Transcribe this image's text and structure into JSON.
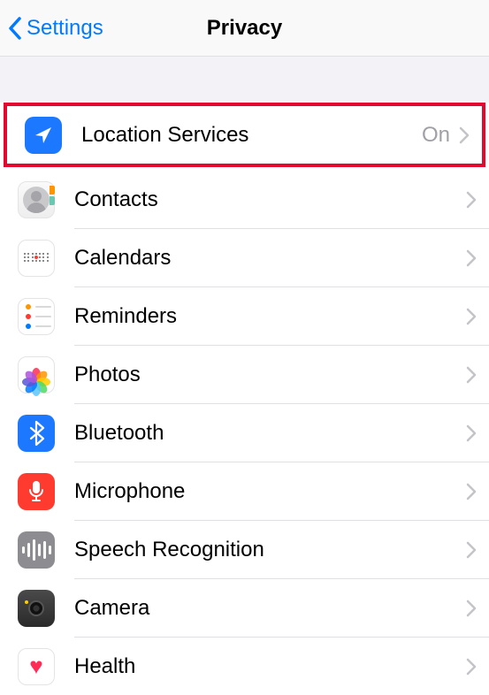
{
  "nav": {
    "back_label": "Settings",
    "title": "Privacy"
  },
  "items": [
    {
      "id": "location-services",
      "label": "Location Services",
      "status": "On",
      "icon": "location-arrow-icon",
      "highlighted": true
    },
    {
      "id": "contacts",
      "label": "Contacts",
      "icon": "contacts-icon"
    },
    {
      "id": "calendars",
      "label": "Calendars",
      "icon": "calendar-icon"
    },
    {
      "id": "reminders",
      "label": "Reminders",
      "icon": "reminders-icon"
    },
    {
      "id": "photos",
      "label": "Photos",
      "icon": "photos-icon"
    },
    {
      "id": "bluetooth",
      "label": "Bluetooth",
      "icon": "bluetooth-icon"
    },
    {
      "id": "microphone",
      "label": "Microphone",
      "icon": "microphone-icon"
    },
    {
      "id": "speech-recognition",
      "label": "Speech Recognition",
      "icon": "waveform-icon"
    },
    {
      "id": "camera",
      "label": "Camera",
      "icon": "camera-icon"
    },
    {
      "id": "health",
      "label": "Health",
      "icon": "heart-icon"
    }
  ]
}
